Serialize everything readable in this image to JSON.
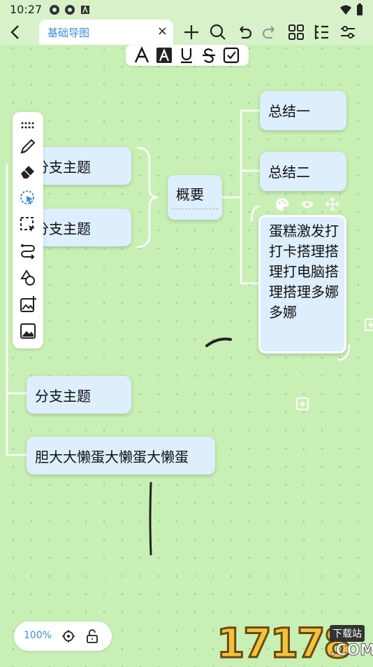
{
  "status_bar": {
    "time": "10:27"
  },
  "tab": {
    "title": "基础导图",
    "close": "×"
  },
  "nodes": {
    "branch1": "分支主题",
    "branch2": "分支主题",
    "branch3": "分支主题",
    "branch4": "胆大大懒蛋大懒蛋大懒蛋",
    "summary": "概要",
    "summary1": "总结一",
    "summary2": "总结二",
    "summary3": "蛋糕激发打打卡搭理搭理打电脑搭理搭理多娜多娜"
  },
  "zoom": {
    "level": "100%"
  },
  "watermark": {
    "number": "17178",
    "tag": "下载站",
    "domain": ".COM"
  },
  "colors": {
    "canvas": "#c8f0b4",
    "node": "#ddeefc",
    "accent": "#3a8fe0",
    "line": "#ffffff"
  }
}
